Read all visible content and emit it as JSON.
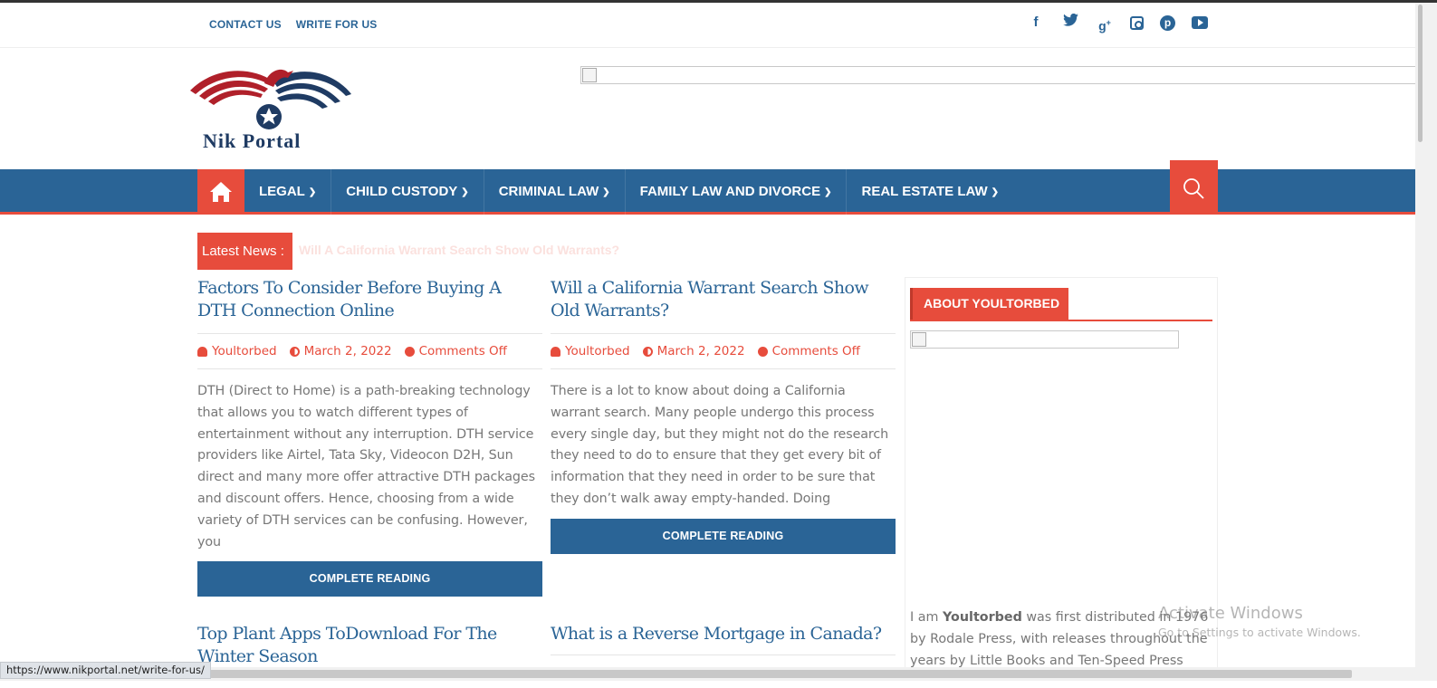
{
  "top_links": [
    "CONTACT US",
    "WRITE FOR US"
  ],
  "social_icons": [
    "facebook-icon",
    "twitter-icon",
    "google-plus-icon",
    "instagram-icon",
    "pinterest-icon",
    "youtube-icon"
  ],
  "brand": {
    "logo_text": "Nik Portal"
  },
  "nav": {
    "items": [
      "LEGAL",
      "CHILD CUSTODY",
      "CRIMINAL LAW",
      "FAMILY LAW AND DIVORCE",
      "REAL ESTATE LAW"
    ]
  },
  "latest": {
    "label": "Latest News :",
    "ticker": "Will A California Warrant Search Show Old Warrants?"
  },
  "articles": [
    {
      "title": "Factors To Consider Before Buying A DTH Connection Online",
      "author": "Youltorbed",
      "date": "March 2, 2022",
      "comments": "Comments Off",
      "excerpt": "DTH (Direct to Home) is a path-breaking technology that allows you to watch different types of entertainment without any interruption. DTH service providers like Airtel, Tata Sky, Videocon D2H, Sun direct and many more offer attractive DTH packages and discount offers. Hence, choosing from a wide variety of DTH services can be confusing. However, you",
      "button": "COMPLETE READING"
    },
    {
      "title": "Will a California Warrant Search Show Old Warrants?",
      "author": "Youltorbed",
      "date": "March 2, 2022",
      "comments": "Comments Off",
      "excerpt": "There is a lot to know about doing a California warrant search. Many people undergo this process every single day, but they might not do the research they need to do to ensure that they get every bit of information that they need in order to be sure that they don’t walk away empty-handed.  Doing",
      "button": "COMPLETE READING"
    },
    {
      "title": "Top Plant Apps ToDownload For The Winter Season"
    },
    {
      "title": "What is a Reverse Mortgage in Canada?"
    }
  ],
  "sidebar": {
    "heading": "ABOUT YOULTORBED",
    "text_prefix": "I am ",
    "text_bold": "Youltorbed",
    "text_rest": " was first distributed in 1976 by Rodale Press, with releases throughout the years by Little Books and Ten-Speed Press"
  },
  "watermark": {
    "line1": "Activate Windows",
    "line2": "Go to Settings to activate Windows."
  },
  "status_url": "https://www.nikportal.net/write-for-us/",
  "colors": {
    "primary": "#2a6496",
    "accent": "#e74c3c"
  }
}
